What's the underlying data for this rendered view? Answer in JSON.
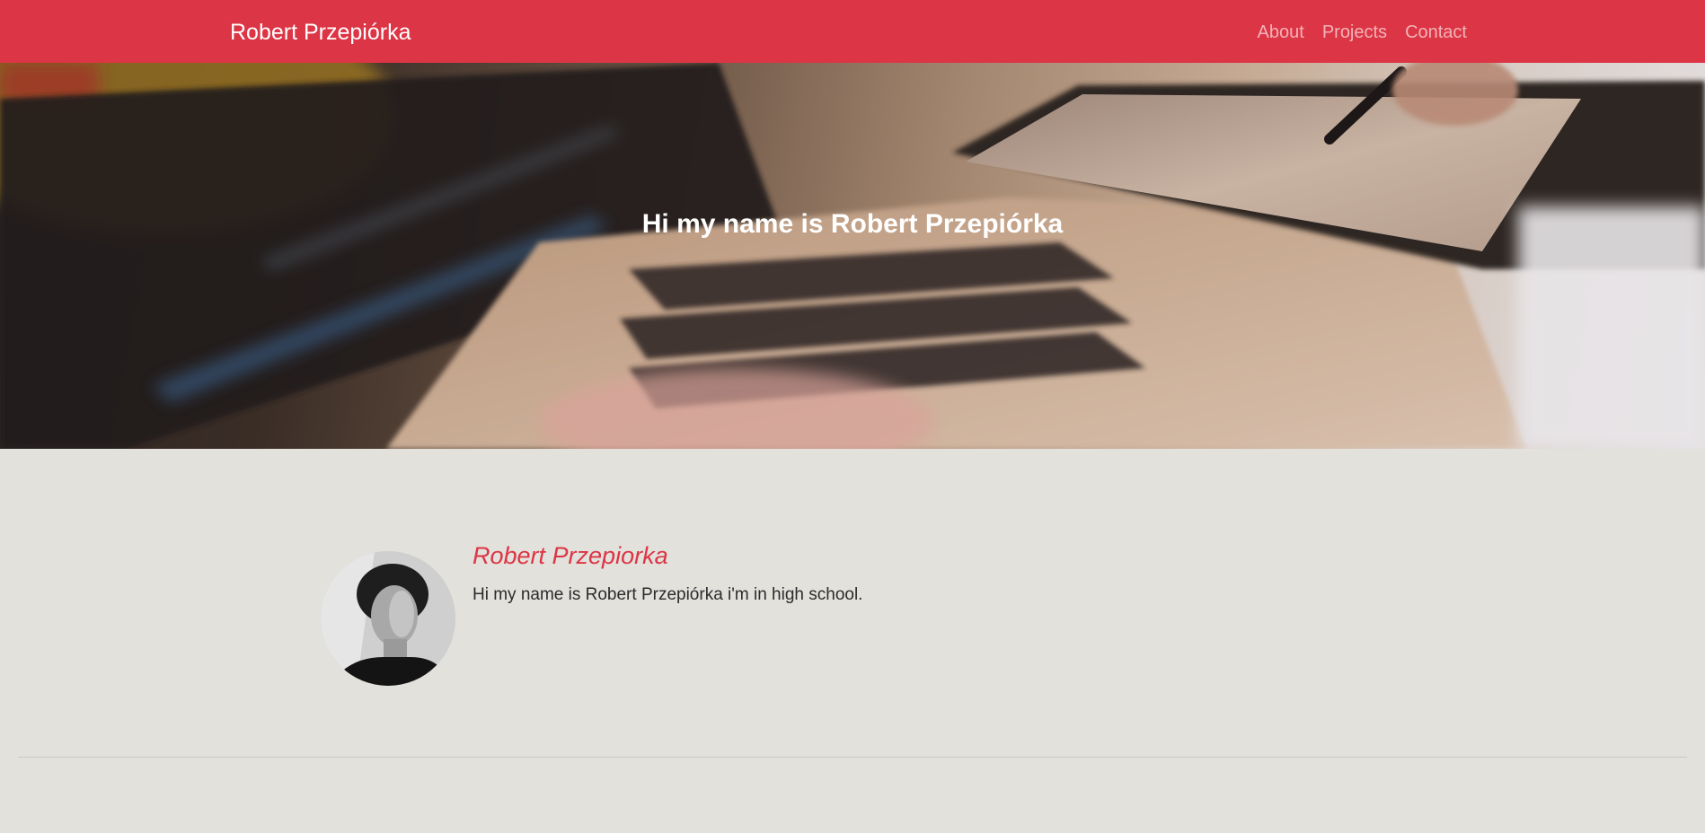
{
  "navbar": {
    "brand": "Robert Przepiórka",
    "links": [
      "About",
      "Projects",
      "Contact"
    ],
    "color": "#dc3545"
  },
  "hero": {
    "title": "Hi my name is Robert Przepiórka"
  },
  "about": {
    "name": "Robert Przepiorka",
    "description": "Hi my name is Robert Przepiórka i'm in high school.",
    "avatar_icon": "person-portrait"
  }
}
